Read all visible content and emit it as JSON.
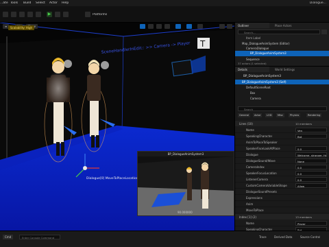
{
  "menu": {
    "items": [
      "...ate",
      "Tools",
      "Build",
      "Select",
      "Actor",
      "Help"
    ],
    "project": "Dialogue..."
  },
  "toolbar": {
    "platforms_label": "Platforms"
  },
  "viewport": {
    "chip_lit": "Lit",
    "chip_show": "Show",
    "scalability": "Scalability: High",
    "floating_text": "SceneHandlerInEdit:: >> Camera -> Player",
    "gizmo_label": "Dialogue[0] MoveToPlaceLocation",
    "preview_title": "BP_DialogueAnimSystem3",
    "preview_value": "90.000000"
  },
  "outliner": {
    "tabs": [
      "Outliner",
      "Place Actors"
    ],
    "search_placeholder": "Search...",
    "column_label": "Item Label",
    "items": [
      "Map_DialogueAnimSystem (Editor)",
      "CameraDialogue",
      "Sequence",
      "BP_DialogueAnimSystem3"
    ],
    "count": "37 actors (1 selected)"
  },
  "details": {
    "tabs": [
      "Details",
      "World Settings"
    ],
    "actor_name": "BP_DialogueAnimSystem3",
    "self_label": "BP_DialogueAnimSystem3 (Self)",
    "tree": [
      "DefaultSceneRoot",
      "Box",
      "Camera"
    ],
    "search_placeholder": "Search",
    "filters": [
      "General",
      "Actor",
      "LOD",
      "Misc",
      "Physics",
      "Rendering"
    ],
    "array_header": "Lines (10)",
    "array_count": "10 members",
    "rows": [
      {
        "label": "Name",
        "value": "Ven"
      },
      {
        "label": "SpeakingCharacter",
        "value": "Bot"
      },
      {
        "label": "AnimToPlaceToSpeaker",
        "value": ""
      },
      {
        "label": "SpeakerFaceLookAtPlace",
        "value": "0.0"
      },
      {
        "label": "Dialogue",
        "value": "Welcome, stranger. Half meant..."
      },
      {
        "label": "DialogueSound/Wave",
        "value": "None"
      },
      {
        "label": "CameraIndex",
        "value": "0.0"
      },
      {
        "label": "SpeakerFocusLocation",
        "value": "0.0"
      },
      {
        "label": "ListenerCamera",
        "value": "0.0"
      },
      {
        "label": "CustomCameraVariableShape",
        "value": "Allow"
      },
      {
        "label": "DialogueSoundPresets",
        "value": ""
      },
      {
        "label": "Expressions",
        "value": ""
      },
      {
        "label": "Anim",
        "value": ""
      },
      {
        "label": "MoveToPlace",
        "value": ""
      }
    ],
    "array2_header": "Index [1] (2)",
    "array2_count": "13 members",
    "rows2": [
      {
        "label": "Name",
        "value": "Player"
      },
      {
        "label": "SpeakingCharacter",
        "value": "Bot"
      }
    ]
  },
  "statusbar": {
    "cmd_label": "Cmd",
    "console_placeholder": "Enter Console Command",
    "trace": "Trace",
    "derived": "Derived Data",
    "source": "Source Control"
  },
  "colors": {
    "accent": "#1d5fa8",
    "highlight": "#0e63b8",
    "floor": "#0a1fb8",
    "gold": "#e3a21a"
  }
}
